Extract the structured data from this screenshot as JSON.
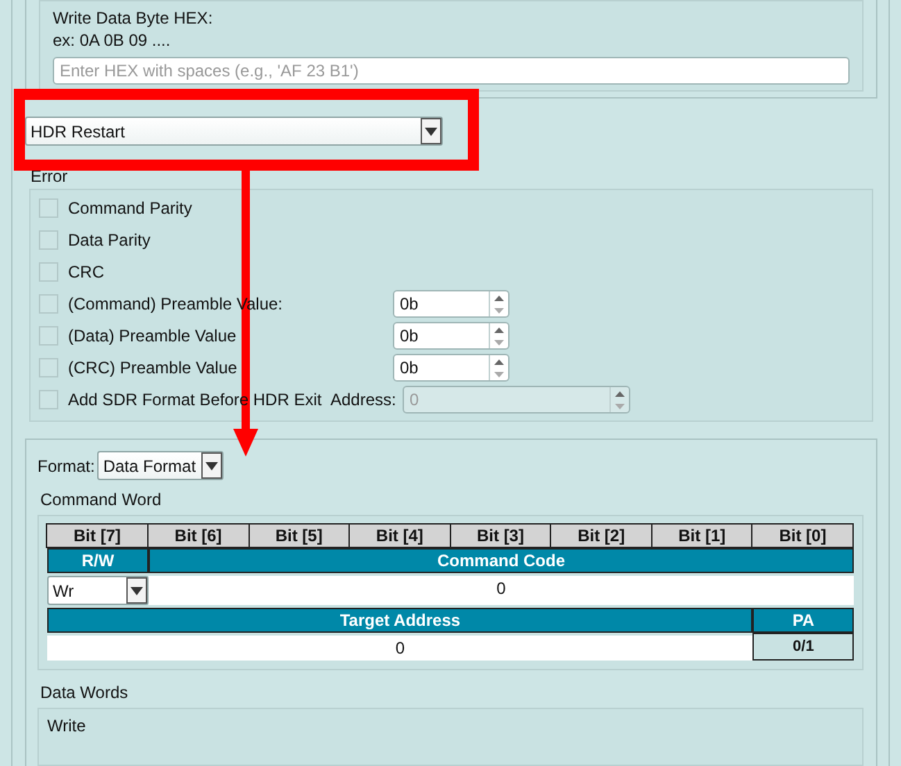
{
  "write_section": {
    "label": "Write Data Byte HEX:",
    "example": "ex: 0A 0B 09 ....",
    "input": {
      "placeholder": "Enter HEX with spaces (e.g., 'AF 23 B1')"
    }
  },
  "command_select": {
    "value": "HDR Restart"
  },
  "error_section": {
    "title": "Error",
    "options": [
      {
        "kind": "check",
        "label": "Command Parity",
        "checked": false
      },
      {
        "kind": "check",
        "label": "Data Parity",
        "checked": false
      },
      {
        "kind": "check",
        "label": "CRC",
        "checked": false
      },
      {
        "kind": "spin",
        "label": "(Command) Preamble Value:",
        "checked": false,
        "value": "0b"
      },
      {
        "kind": "spin",
        "label": "(Data) Preamble Value",
        "checked": false,
        "value": "0b"
      },
      {
        "kind": "spin",
        "label": "(CRC) Preamble Value",
        "checked": false,
        "value": "0b"
      },
      {
        "kind": "address",
        "label": "Add SDR Format Before HDR Exit",
        "checked": false,
        "field_label": "Address:",
        "value": "0",
        "disabled": true
      }
    ]
  },
  "format": {
    "label": "Format:",
    "value": "Data Format"
  },
  "command_word": {
    "title": "Command Word",
    "bits": [
      "Bit [7]",
      "Bit [6]",
      "Bit [5]",
      "Bit [4]",
      "Bit [3]",
      "Bit [2]",
      "Bit [1]",
      "Bit [0]"
    ],
    "rw_header": "R/W",
    "code_header": "Command Code",
    "rw_value": "Wr",
    "code_value": "0",
    "address_header": "Target Address",
    "pa_header": "PA",
    "address_value": "0",
    "pa_value": "0/1"
  },
  "data_words": {
    "title": "Data Words",
    "write_title": "Write"
  }
}
